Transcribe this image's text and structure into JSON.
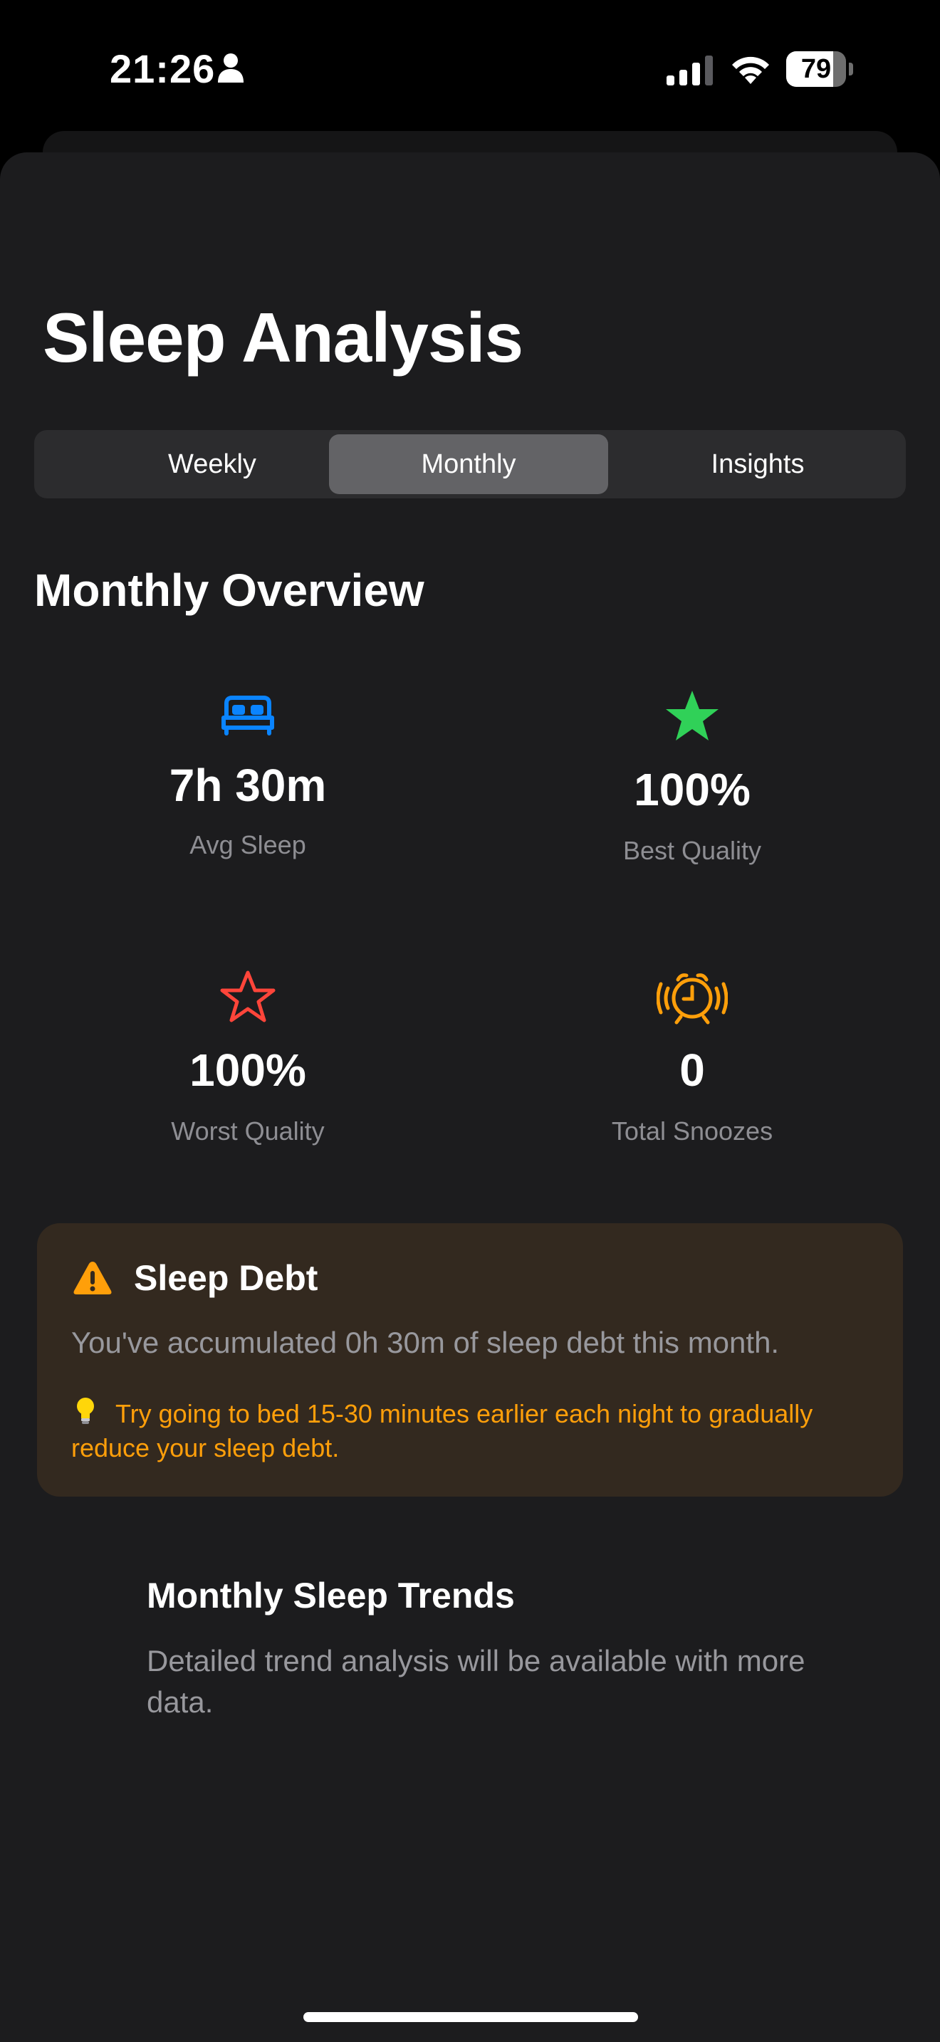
{
  "status_bar": {
    "time": "21:26",
    "battery_level": "79",
    "battery_fraction": 0.79
  },
  "page": {
    "title": "Sleep Analysis"
  },
  "segments": [
    {
      "label": "Weekly",
      "selected": false
    },
    {
      "label": "Monthly",
      "selected": true
    },
    {
      "label": "Insights",
      "selected": false
    }
  ],
  "overview": {
    "title": "Monthly Overview",
    "stats": [
      {
        "icon": "bed-icon",
        "value": "7h 30m",
        "label": "Avg Sleep",
        "color": "#0a84ff"
      },
      {
        "icon": "star-filled-icon",
        "value": "100%",
        "label": "Best Quality",
        "color": "#30d158"
      },
      {
        "icon": "star-outline-icon",
        "value": "100%",
        "label": "Worst Quality",
        "color": "#ff453a"
      },
      {
        "icon": "alarm-clock-icon",
        "value": "0",
        "label": "Total Snoozes",
        "color": "#ff9f0a"
      }
    ]
  },
  "sleep_debt": {
    "icon": "warning-icon",
    "title": "Sleep Debt",
    "message": "You've accumulated 0h 30m of sleep debt this month.",
    "tip_icon": "lightbulb-icon",
    "tip": "Try going to bed 15-30 minutes earlier each night to gradually reduce your sleep debt.",
    "accent": "#ff9f0a"
  },
  "trends": {
    "title": "Monthly Sleep Trends",
    "description": "Detailed trend analysis will be available with more data."
  }
}
